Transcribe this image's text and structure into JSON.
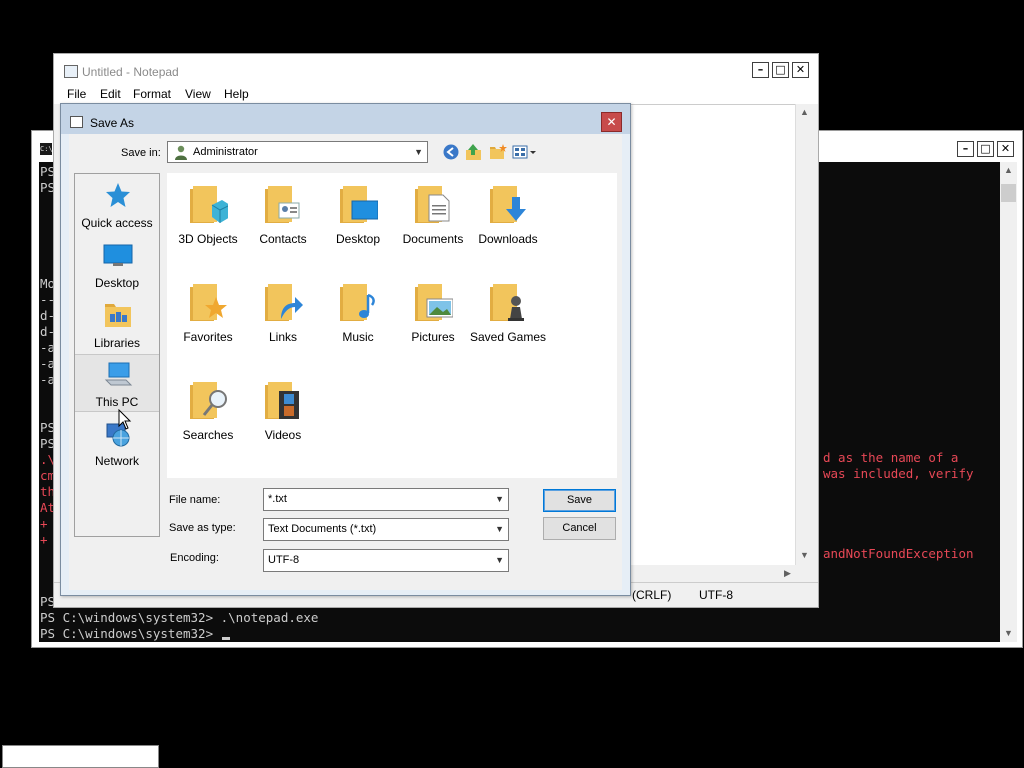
{
  "powershell": {
    "prompt_lines": [
      {
        "text": "PS"
      },
      {
        "text": "PS"
      }
    ],
    "left_fragments": [
      "Mo",
      "--",
      "d-",
      "d-",
      "-a",
      "-a",
      "-a"
    ],
    "prompt_fragments": [
      "PS",
      "PS"
    ],
    "error_left": [
      ".\\",
      "cm",
      "th",
      "At",
      "+",
      "+"
    ],
    "error_right": [
      "d as the name of a",
      "was included, verify"
    ],
    "error_right2": "andNotFoundException",
    "ps_short": "PS",
    "cmd_line": "PS C:\\windows\\system32> .\\notepad.exe",
    "current_prompt": "PS C:\\windows\\system32> "
  },
  "notepad": {
    "title": "Untitled - Notepad",
    "menu": [
      "File",
      "Edit",
      "Format",
      "View",
      "Help"
    ],
    "status": {
      "line_ending": "(CRLF)",
      "encoding": "UTF-8"
    }
  },
  "dialog": {
    "title": "Save As",
    "save_in_label": "Save in:",
    "save_in_value": "Administrator",
    "places": [
      "Quick access",
      "Desktop",
      "Libraries",
      "This PC",
      "Network"
    ],
    "folders": [
      "3D Objects",
      "Contacts",
      "Desktop",
      "Documents",
      "Downloads",
      "Favorites",
      "Links",
      "Music",
      "Pictures",
      "Saved Games",
      "Searches",
      "Videos"
    ],
    "file_name_label": "File name:",
    "file_name_value": "*.txt",
    "save_type_label": "Save as type:",
    "save_type_value": "Text Documents (*.txt)",
    "encoding_label": "Encoding:",
    "encoding_value": "UTF-8",
    "save_button": "Save",
    "cancel_button": "Cancel"
  },
  "icons": {
    "minimize": "minimize-icon",
    "maximize": "maximize-icon",
    "close": "close-icon",
    "back": "back-arrow-icon",
    "up": "up-folder-icon",
    "new_folder": "new-folder-icon",
    "view": "view-menu-icon"
  },
  "colors": {
    "console_bg": "#0c0c0c",
    "console_fg": "#cccccc",
    "console_error": "#e74856",
    "dialog_title": "#c4d4e6",
    "folder": "#f2c55c",
    "close_red": "#c74b4b"
  }
}
